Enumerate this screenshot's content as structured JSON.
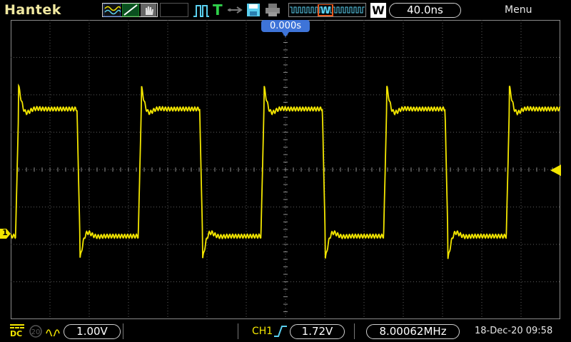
{
  "header": {
    "brand": "Hantek",
    "timebase": "40.0ns",
    "window_mode_letter": "W",
    "menu_label": "Menu",
    "icons": [
      "waveform-display-icon",
      "trigger-edge-icon",
      "stop-hand-icon",
      "pulse-trigger-icon",
      "trigger-t-icon",
      "usb-icon",
      "save-disk-icon",
      "printer-icon",
      "waveform-overview-icon"
    ]
  },
  "plot": {
    "trigger_position": "0.000s",
    "channel_marker": "1"
  },
  "footer": {
    "coupling": "DC",
    "volts_per_div": "1.00V",
    "trigger_channel": "CH1",
    "trigger_level": "1.72V",
    "frequency": "8.00062MHz",
    "datetime": "18-Dec-20 09:58"
  },
  "colors": {
    "trace": "#f3e600",
    "grid": "#5c5c5c",
    "trigger_badge": "#3e74d8"
  },
  "chart_data": {
    "type": "line",
    "title": "",
    "xlabel": "",
    "ylabel": "",
    "x_divisions": 14,
    "y_divisions": 8,
    "x_range_ns": [
      -280,
      280
    ],
    "y_range_div": [
      -4,
      4
    ],
    "series": [
      {
        "waveform": "square",
        "frequency_mhz": 8.00062,
        "period_ns": 125,
        "high_level_div": 1.62,
        "low_level_div": -1.78,
        "overshoot_div": 0.62,
        "undershoot_div": 0.62,
        "rising_edge_at_ns": [
          -275,
          -150,
          -25,
          100,
          225
        ]
      }
    ]
  }
}
